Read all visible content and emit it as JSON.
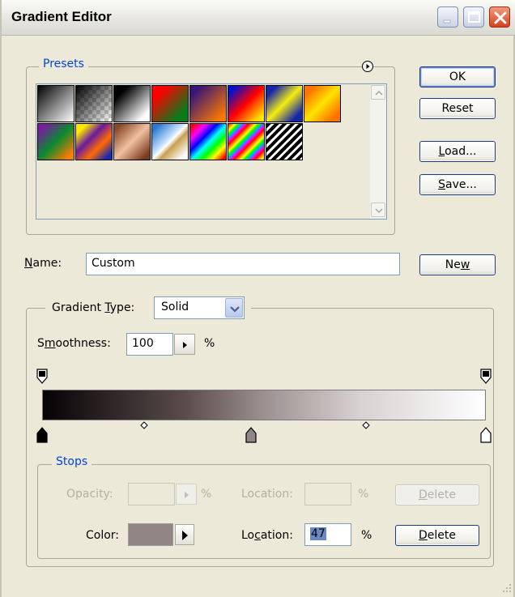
{
  "window": {
    "title": "Gradient Editor"
  },
  "presets": {
    "legend": "Presets",
    "swatches": [
      {
        "name": "foreground-to-background",
        "css": "linear-gradient(135deg,#000 0%,#fff 100%)"
      },
      {
        "name": "foreground-to-transparent",
        "css": "linear-gradient(135deg,#000 0%,rgba(0,0,0,0) 100%), repeating-conic-gradient(#cfcfcf 0% 25%, #ffffff 0% 50%) 0 0/10px 10px"
      },
      {
        "name": "black-white",
        "css": "linear-gradient(135deg,#000 20%,#fff 85%)"
      },
      {
        "name": "red-green",
        "css": "linear-gradient(135deg,#ff0000 20%,#0a7a1c 80%)"
      },
      {
        "name": "violet-orange",
        "css": "linear-gradient(135deg,#3a1676 15%,#ff7a00 90%)"
      },
      {
        "name": "blue-red-yellow",
        "css": "linear-gradient(135deg,#0010d0 10%,#ff0000 50%,#ffe800 90%)"
      },
      {
        "name": "blue-yellow-blue",
        "css": "linear-gradient(135deg,#1626a8 15%,#f5ee10 50%,#1626a8 85%)"
      },
      {
        "name": "orange-yellow-orange",
        "css": "linear-gradient(135deg,#ff7400 15%,#ffe400 50%,#ff7400 85%)"
      },
      {
        "name": "violet-green-orange",
        "css": "linear-gradient(135deg,#7a1aa0 10%,#0a8a30 50%,#ff7d00 90%)"
      },
      {
        "name": "yellow-violet-orange-blue",
        "css": "linear-gradient(135deg,#ffe800 15%,#6a1aa0 40%,#ff6a00 65%,#1a2ab0 90%)"
      },
      {
        "name": "copper",
        "css": "linear-gradient(135deg,#8a4a28 10%,#f0c0a0 50%,#7a3a20 90%)"
      },
      {
        "name": "chrome",
        "css": "linear-gradient(135deg,#2a78d0 10%,#d0e8ff 45%,#ffffff 50%,#c8a050 60%,#ffffff 90%)"
      },
      {
        "name": "spectrum",
        "css": "linear-gradient(135deg,#ff0000 5%,#ff00ff 22%,#0000ff 38%,#00ffff 52%,#00ff00 66%,#ffff00 80%,#ff0000 95%)"
      },
      {
        "name": "transparent-rainbow",
        "css": "repeating-linear-gradient(135deg,#ff0000 0px,#ff8800 3px,#ffff00 6px,#00ff00 9px,#00aaff 12px,#ff00ff 15px,#ff0000 18px)"
      },
      {
        "name": "transparent-stripes",
        "css": "repeating-linear-gradient(135deg,#000 0px,#000 4px,#fff 4px,#fff 7px)"
      }
    ]
  },
  "buttons": {
    "ok": "OK",
    "reset": "Reset",
    "load": "Load...",
    "save": "Save...",
    "new": "New"
  },
  "name_field": {
    "label": "Name:",
    "value": "Custom"
  },
  "gradient": {
    "type_label": "Gradient Type:",
    "type_value": "Solid",
    "smoothness_label": "Smoothness:",
    "smoothness_value": "100",
    "percent": "%",
    "bar_css": "linear-gradient(to right,#050304 0%,#5a4b4c 32%,#9c9091 50%,#d8d2d2 72%,#ffffff 100%)",
    "opacity_stops": [
      0,
      100
    ],
    "color_stops": [
      0,
      47,
      100
    ],
    "midpoints": [
      23,
      73
    ]
  },
  "stops": {
    "legend": "Stops",
    "opacity_label": "Opacity:",
    "opacity_unit": "%",
    "location_label_1": "Location:",
    "location_unit_1": "%",
    "delete_1": "Delete",
    "color_label": "Color:",
    "color_value": "#918586",
    "location_label_2": "Location:",
    "location_value": "47",
    "location_unit_2": "%",
    "delete_2": "Delete"
  },
  "colors": {
    "accent": "#0046d5",
    "dialog_bg": "#ece9d8"
  }
}
